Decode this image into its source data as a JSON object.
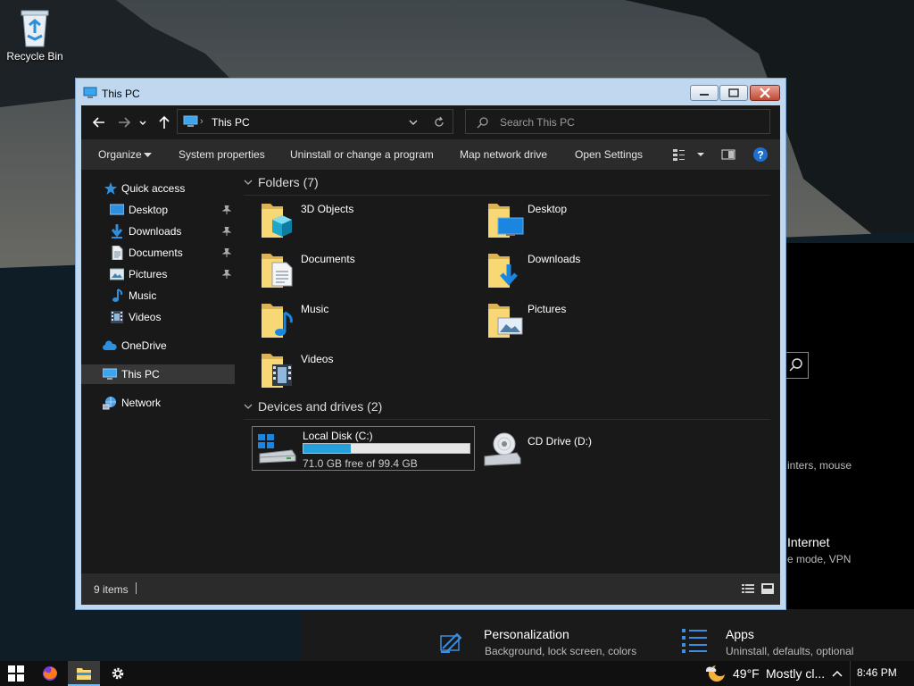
{
  "desktop": {
    "icons": [
      {
        "label": "Recycle Bin",
        "icon": "recycle-bin-icon"
      }
    ]
  },
  "settings_background": {
    "visible_texts": [
      {
        "key": "printers",
        "text": "inters, mouse"
      },
      {
        "key": "network_title",
        "text": "Internet"
      },
      {
        "key": "network_sub",
        "text": "e mode, VPN"
      }
    ],
    "tiles": [
      {
        "title": "Personalization",
        "subtitle": "Background, lock screen, colors",
        "icon": "personalization-icon"
      },
      {
        "title": "Apps",
        "subtitle": "Uninstall, defaults, optional",
        "icon": "apps-icon"
      }
    ]
  },
  "window": {
    "title": "This PC",
    "address": {
      "path": "This PC"
    },
    "search": {
      "placeholder": "Search This PC"
    },
    "commands": {
      "organize": "Organize",
      "system_properties": "System properties",
      "uninstall": "Uninstall or change a program",
      "map_drive": "Map network drive",
      "open_settings": "Open Settings"
    },
    "nav_pane": [
      {
        "label": "Quick access",
        "icon": "star-icon",
        "pinned": false
      },
      {
        "label": "Desktop",
        "icon": "desktop-icon",
        "pinned": true
      },
      {
        "label": "Downloads",
        "icon": "download-arrow-icon",
        "pinned": true
      },
      {
        "label": "Documents",
        "icon": "document-icon",
        "pinned": true
      },
      {
        "label": "Pictures",
        "icon": "picture-icon",
        "pinned": true
      },
      {
        "label": "Music",
        "icon": "music-note-icon",
        "pinned": false
      },
      {
        "label": "Videos",
        "icon": "film-icon",
        "pinned": false
      },
      {
        "label": "OneDrive",
        "icon": "cloud-icon",
        "pinned": false
      },
      {
        "label": "This PC",
        "icon": "computer-icon",
        "pinned": false,
        "selected": true
      },
      {
        "label": "Network",
        "icon": "network-icon",
        "pinned": false
      }
    ],
    "groups": {
      "folders_header": "Folders (7)",
      "devices_header": "Devices and drives (2)"
    },
    "folders": [
      {
        "label": "3D Objects",
        "icon": "3d-objects-folder-icon"
      },
      {
        "label": "Desktop",
        "icon": "desktop-folder-icon"
      },
      {
        "label": "Documents",
        "icon": "documents-folder-icon"
      },
      {
        "label": "Downloads",
        "icon": "downloads-folder-icon"
      },
      {
        "label": "Music",
        "icon": "music-folder-icon"
      },
      {
        "label": "Pictures",
        "icon": "pictures-folder-icon"
      },
      {
        "label": "Videos",
        "icon": "videos-folder-icon"
      }
    ],
    "drives": [
      {
        "label": "Local Disk (C:)",
        "free_text": "71.0 GB free of 99.4 GB",
        "used_fraction": 0.286,
        "icon": "hard-drive-icon",
        "selected": true
      },
      {
        "label": "CD Drive (D:)",
        "icon": "cd-drive-icon"
      }
    ],
    "status": {
      "item_count": "9 items"
    }
  },
  "taskbar": {
    "pinned": [
      "windows-start-icon",
      "firefox-icon",
      "file-explorer-icon",
      "settings-gear-icon"
    ],
    "weather": {
      "temp": "49°F",
      "condition": "Mostly cl..."
    },
    "clock": "8:46 PM"
  },
  "colors": {
    "accent": "#26a0da",
    "folder_yellow": "#f8d775",
    "explorer_bg": "#191919",
    "toolbar_bg": "#2b2b2b",
    "selection": "#373737",
    "aero_frame": "#bfd8f0"
  }
}
